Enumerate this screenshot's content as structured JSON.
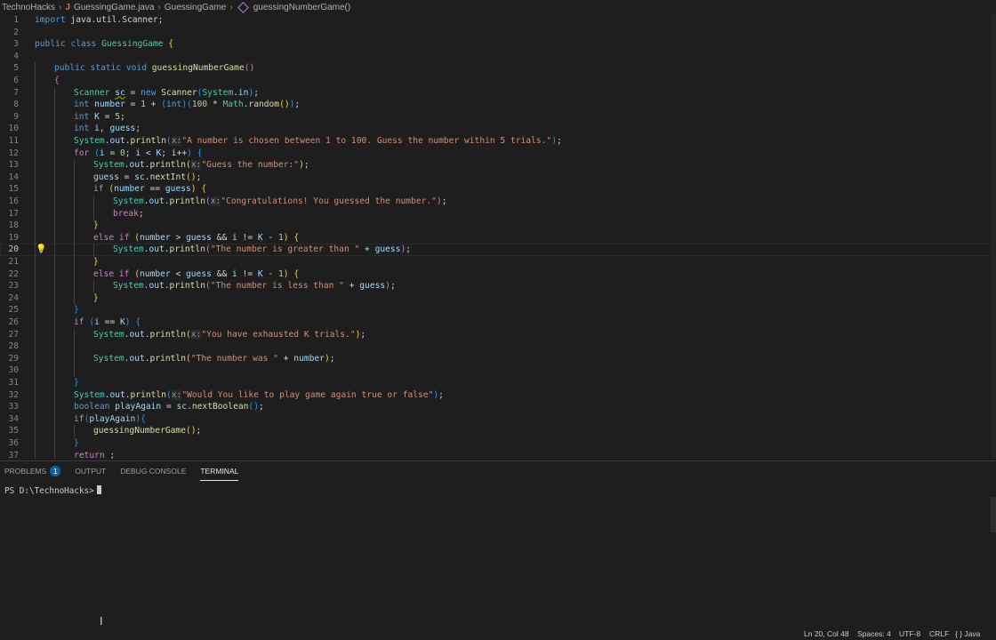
{
  "breadcrumb": {
    "folder": "TechnoHacks",
    "file_icon": "J",
    "file": "GuessingGame.java",
    "class": "GuessingGame",
    "method": "guessingNumberGame()"
  },
  "editor": {
    "current_line": 20,
    "lines": [
      {
        "n": "1",
        "indent": 0,
        "tokens": [
          [
            "kw",
            "import"
          ],
          [
            "p",
            " java.util.Scanner;"
          ]
        ]
      },
      {
        "n": "2",
        "indent": 0,
        "tokens": []
      },
      {
        "n": "3",
        "indent": 0,
        "tokens": [
          [
            "kw",
            "public"
          ],
          [
            "p",
            " "
          ],
          [
            "kw",
            "class"
          ],
          [
            "p",
            " "
          ],
          [
            "ty",
            "GuessingGame"
          ],
          [
            "p",
            " "
          ],
          [
            "b1",
            "{"
          ]
        ]
      },
      {
        "n": "4",
        "indent": 0,
        "tokens": []
      },
      {
        "n": "5",
        "indent": 1,
        "tokens": [
          [
            "kw",
            "public"
          ],
          [
            "p",
            " "
          ],
          [
            "kw",
            "static"
          ],
          [
            "p",
            " "
          ],
          [
            "kw",
            "void"
          ],
          [
            "p",
            " "
          ],
          [
            "fn",
            "guessingNumberGame"
          ],
          [
            "b2",
            "()"
          ]
        ]
      },
      {
        "n": "6",
        "indent": 1,
        "tokens": [
          [
            "b2",
            "{"
          ]
        ]
      },
      {
        "n": "7",
        "indent": 2,
        "tokens": [
          [
            "ty",
            "Scanner"
          ],
          [
            "p",
            " "
          ],
          [
            "var squig",
            "sc"
          ],
          [
            "p",
            " = "
          ],
          [
            "kw",
            "new"
          ],
          [
            "p",
            " "
          ],
          [
            "fn",
            "Scanner"
          ],
          [
            "b3",
            "("
          ],
          [
            "ty",
            "System"
          ],
          [
            "p",
            "."
          ],
          [
            "var",
            "in"
          ],
          [
            "b3",
            ")"
          ],
          [
            "p",
            ";"
          ]
        ]
      },
      {
        "n": "8",
        "indent": 2,
        "tokens": [
          [
            "kw",
            "int"
          ],
          [
            "p",
            " "
          ],
          [
            "var",
            "number"
          ],
          [
            "p",
            " = "
          ],
          [
            "num",
            "1"
          ],
          [
            "p",
            " + "
          ],
          [
            "b3",
            "("
          ],
          [
            "kw",
            "int"
          ],
          [
            "b3",
            ")"
          ],
          [
            "b3",
            "("
          ],
          [
            "num",
            "100"
          ],
          [
            "p",
            " * "
          ],
          [
            "ty",
            "Math"
          ],
          [
            "p",
            "."
          ],
          [
            "fn",
            "random"
          ],
          [
            "b1",
            "()"
          ],
          [
            "b3",
            ")"
          ],
          [
            "p",
            ";"
          ]
        ]
      },
      {
        "n": "9",
        "indent": 2,
        "tokens": [
          [
            "kw",
            "int"
          ],
          [
            "p",
            " "
          ],
          [
            "var",
            "K"
          ],
          [
            "p",
            " = "
          ],
          [
            "num",
            "5"
          ],
          [
            "p",
            ";"
          ]
        ]
      },
      {
        "n": "10",
        "indent": 2,
        "tokens": [
          [
            "kw",
            "int"
          ],
          [
            "p",
            " "
          ],
          [
            "var",
            "i"
          ],
          [
            "p",
            ", "
          ],
          [
            "var",
            "guess"
          ],
          [
            "p",
            ";"
          ]
        ]
      },
      {
        "n": "11",
        "indent": 2,
        "tokens": [
          [
            "ty",
            "System"
          ],
          [
            "p",
            "."
          ],
          [
            "var",
            "out"
          ],
          [
            "p",
            "."
          ],
          [
            "fn",
            "println"
          ],
          [
            "b3",
            "("
          ],
          [
            "hint",
            "x:"
          ],
          [
            "str",
            "\"A number is chosen between 1 to 100. Guess the number within 5 trials.\""
          ],
          [
            "b3",
            ")"
          ],
          [
            "p",
            ";"
          ]
        ]
      },
      {
        "n": "12",
        "indent": 2,
        "tokens": [
          [
            "ctl",
            "for"
          ],
          [
            "p",
            " "
          ],
          [
            "b3",
            "("
          ],
          [
            "var",
            "i"
          ],
          [
            "p",
            " = "
          ],
          [
            "num",
            "0"
          ],
          [
            "p",
            "; "
          ],
          [
            "var",
            "i"
          ],
          [
            "p",
            " < "
          ],
          [
            "var",
            "K"
          ],
          [
            "p",
            "; "
          ],
          [
            "var",
            "i"
          ],
          [
            "p",
            "++"
          ],
          [
            "b3",
            ")"
          ],
          [
            "p",
            " "
          ],
          [
            "b3",
            "{"
          ]
        ]
      },
      {
        "n": "13",
        "indent": 3,
        "tokens": [
          [
            "ty",
            "System"
          ],
          [
            "p",
            "."
          ],
          [
            "var",
            "out"
          ],
          [
            "p",
            "."
          ],
          [
            "fn",
            "println"
          ],
          [
            "b1",
            "("
          ],
          [
            "hint",
            "x:"
          ],
          [
            "str",
            "\"Guess the number:\""
          ],
          [
            "b1",
            ")"
          ],
          [
            "p",
            ";"
          ]
        ]
      },
      {
        "n": "14",
        "indent": 3,
        "tokens": [
          [
            "var",
            "guess"
          ],
          [
            "p",
            " = "
          ],
          [
            "var",
            "sc"
          ],
          [
            "p",
            "."
          ],
          [
            "fn",
            "nextInt"
          ],
          [
            "b1",
            "()"
          ],
          [
            "p",
            ";"
          ]
        ]
      },
      {
        "n": "15",
        "indent": 3,
        "tokens": [
          [
            "ctl",
            "if"
          ],
          [
            "p",
            " "
          ],
          [
            "b1",
            "("
          ],
          [
            "var",
            "number"
          ],
          [
            "p",
            " == "
          ],
          [
            "var",
            "guess"
          ],
          [
            "b1",
            ")"
          ],
          [
            "p",
            " "
          ],
          [
            "b1",
            "{"
          ]
        ]
      },
      {
        "n": "16",
        "indent": 4,
        "tokens": [
          [
            "ty",
            "System"
          ],
          [
            "p",
            "."
          ],
          [
            "var",
            "out"
          ],
          [
            "p",
            "."
          ],
          [
            "fn",
            "println"
          ],
          [
            "b2",
            "("
          ],
          [
            "hint",
            "x:"
          ],
          [
            "str",
            "\"Congratulations! You guessed the number.\""
          ],
          [
            "b2",
            ")"
          ],
          [
            "p",
            ";"
          ]
        ]
      },
      {
        "n": "17",
        "indent": 4,
        "tokens": [
          [
            "ctl",
            "break"
          ],
          [
            "p",
            ";"
          ]
        ]
      },
      {
        "n": "18",
        "indent": 3,
        "tokens": [
          [
            "b1",
            "}"
          ]
        ]
      },
      {
        "n": "19",
        "indent": 3,
        "tokens": [
          [
            "ctl",
            "else"
          ],
          [
            "p",
            " "
          ],
          [
            "ctl",
            "if"
          ],
          [
            "p",
            " "
          ],
          [
            "b1",
            "("
          ],
          [
            "var",
            "number"
          ],
          [
            "p",
            " > "
          ],
          [
            "var",
            "guess"
          ],
          [
            "p",
            " && "
          ],
          [
            "var",
            "i"
          ],
          [
            "p",
            " != "
          ],
          [
            "var",
            "K"
          ],
          [
            "p",
            " - "
          ],
          [
            "num",
            "1"
          ],
          [
            "b1",
            ")"
          ],
          [
            "p",
            " "
          ],
          [
            "b1",
            "{"
          ]
        ]
      },
      {
        "n": "20",
        "indent": 4,
        "tokens": [
          [
            "ty",
            "System"
          ],
          [
            "p",
            "."
          ],
          [
            "var",
            "out"
          ],
          [
            "p",
            "."
          ],
          [
            "fn",
            "println"
          ],
          [
            "b2",
            "("
          ],
          [
            "str",
            "\"The number is greater than \""
          ],
          [
            "p",
            " + "
          ],
          [
            "var",
            "guess"
          ],
          [
            "b2",
            ")"
          ],
          [
            "p",
            ";"
          ]
        ]
      },
      {
        "n": "21",
        "indent": 3,
        "tokens": [
          [
            "b1",
            "}"
          ]
        ]
      },
      {
        "n": "22",
        "indent": 3,
        "tokens": [
          [
            "ctl",
            "else"
          ],
          [
            "p",
            " "
          ],
          [
            "ctl",
            "if"
          ],
          [
            "p",
            " "
          ],
          [
            "b1",
            "("
          ],
          [
            "var",
            "number"
          ],
          [
            "p",
            " < "
          ],
          [
            "var",
            "guess"
          ],
          [
            "p",
            " && "
          ],
          [
            "var",
            "i"
          ],
          [
            "p",
            " != "
          ],
          [
            "var",
            "K"
          ],
          [
            "p",
            " - "
          ],
          [
            "num",
            "1"
          ],
          [
            "b1",
            ")"
          ],
          [
            "p",
            " "
          ],
          [
            "b1",
            "{"
          ]
        ]
      },
      {
        "n": "23",
        "indent": 4,
        "tokens": [
          [
            "ty",
            "System"
          ],
          [
            "p",
            "."
          ],
          [
            "var",
            "out"
          ],
          [
            "p",
            "."
          ],
          [
            "fn",
            "println"
          ],
          [
            "b2",
            "("
          ],
          [
            "str",
            "\"The number is less than \""
          ],
          [
            "p",
            " + "
          ],
          [
            "var",
            "guess"
          ],
          [
            "b2",
            ")"
          ],
          [
            "p",
            ";"
          ]
        ]
      },
      {
        "n": "24",
        "indent": 3,
        "tokens": [
          [
            "b1",
            "}"
          ]
        ]
      },
      {
        "n": "25",
        "indent": 2,
        "tokens": [
          [
            "b3",
            "}"
          ]
        ]
      },
      {
        "n": "26",
        "indent": 2,
        "tokens": [
          [
            "ctl",
            "if"
          ],
          [
            "p",
            " "
          ],
          [
            "b3",
            "("
          ],
          [
            "var",
            "i"
          ],
          [
            "p",
            " == "
          ],
          [
            "var",
            "K"
          ],
          [
            "b3",
            ")"
          ],
          [
            "p",
            " "
          ],
          [
            "b3",
            "{"
          ]
        ]
      },
      {
        "n": "27",
        "indent": 3,
        "tokens": [
          [
            "ty",
            "System"
          ],
          [
            "p",
            "."
          ],
          [
            "var",
            "out"
          ],
          [
            "p",
            "."
          ],
          [
            "fn",
            "println"
          ],
          [
            "b1",
            "("
          ],
          [
            "hint",
            "x:"
          ],
          [
            "str",
            "\"You have exhausted K trials.\""
          ],
          [
            "b1",
            ")"
          ],
          [
            "p",
            ";"
          ]
        ]
      },
      {
        "n": "28",
        "indent": 3,
        "tokens": []
      },
      {
        "n": "29",
        "indent": 3,
        "tokens": [
          [
            "ty",
            "System"
          ],
          [
            "p",
            "."
          ],
          [
            "var",
            "out"
          ],
          [
            "p",
            "."
          ],
          [
            "fn",
            "println"
          ],
          [
            "b1",
            "("
          ],
          [
            "str",
            "\"The number was \""
          ],
          [
            "p",
            " + "
          ],
          [
            "var",
            "number"
          ],
          [
            "b1",
            ")"
          ],
          [
            "p",
            ";"
          ]
        ]
      },
      {
        "n": "30",
        "indent": 3,
        "tokens": []
      },
      {
        "n": "31",
        "indent": 2,
        "tokens": [
          [
            "b3",
            "}"
          ]
        ]
      },
      {
        "n": "32",
        "indent": 2,
        "tokens": [
          [
            "ty",
            "System"
          ],
          [
            "p",
            "."
          ],
          [
            "var",
            "out"
          ],
          [
            "p",
            "."
          ],
          [
            "fn",
            "println"
          ],
          [
            "b3",
            "("
          ],
          [
            "hint",
            "x:"
          ],
          [
            "str",
            "\"Would You like to play game again true or false\""
          ],
          [
            "b3",
            ")"
          ],
          [
            "p",
            ";"
          ]
        ]
      },
      {
        "n": "33",
        "indent": 2,
        "tokens": [
          [
            "kw",
            "boolean"
          ],
          [
            "p",
            " "
          ],
          [
            "var",
            "playAgain"
          ],
          [
            "p",
            " = "
          ],
          [
            "var",
            "sc"
          ],
          [
            "p",
            "."
          ],
          [
            "fn",
            "nextBoolean"
          ],
          [
            "b3",
            "()"
          ],
          [
            "p",
            ";"
          ]
        ]
      },
      {
        "n": "34",
        "indent": 2,
        "tokens": [
          [
            "ctl",
            "if"
          ],
          [
            "b3",
            "("
          ],
          [
            "var",
            "playAgain"
          ],
          [
            "b3",
            ")"
          ],
          [
            "b3",
            "{"
          ]
        ]
      },
      {
        "n": "35",
        "indent": 3,
        "tokens": [
          [
            "fn",
            "guessingNumberGame"
          ],
          [
            "b1",
            "()"
          ],
          [
            "p",
            ";"
          ]
        ]
      },
      {
        "n": "36",
        "indent": 2,
        "tokens": [
          [
            "b3",
            "}"
          ]
        ]
      },
      {
        "n": "37",
        "indent": 2,
        "tokens": [
          [
            "ctl",
            "return"
          ],
          [
            "p",
            " ;"
          ]
        ]
      }
    ]
  },
  "panel": {
    "tabs": [
      {
        "label": "PROBLEMS",
        "badge": "1",
        "active": false
      },
      {
        "label": "OUTPUT",
        "active": false
      },
      {
        "label": "DEBUG CONSOLE",
        "active": false
      },
      {
        "label": "TERMINAL",
        "active": true
      }
    ],
    "terminal_prompt": "PS D:\\TechnoHacks>"
  },
  "statusbar": {
    "position": "Ln 20, Col 48",
    "spaces": "Spaces: 4",
    "encoding": "UTF-8",
    "eol": "CRLF",
    "language": "{ } Java"
  },
  "icons": {
    "lightbulb": "lightbulb-icon",
    "java_file": "java-file-icon",
    "method": "method-icon",
    "text_cursor": "text-cursor-icon"
  }
}
